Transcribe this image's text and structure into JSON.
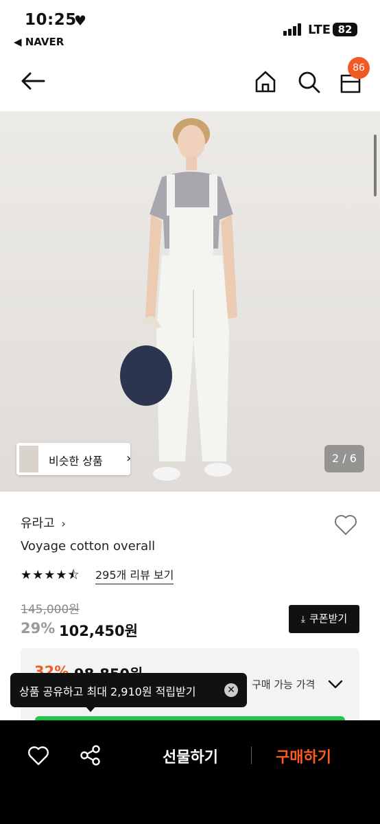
{
  "status": {
    "time": "10:25",
    "back_app": "◀ NAVER",
    "network": "LTE",
    "battery": "82"
  },
  "header": {
    "cart_count": "86"
  },
  "hero": {
    "similar_label": "비슷한 상품",
    "pager": "2 / 6"
  },
  "product": {
    "brand": "유라고",
    "name": "Voyage cotton overall",
    "rating_stars": "★★★★⯪",
    "review_link": "295개 리뷰 보기",
    "original_price": "145,000원",
    "discount": "29%",
    "price": "102,450원",
    "coupon_label": "쿠폰받기"
  },
  "benefit": {
    "discount": "32%",
    "price": "98,850원",
    "label": "구매 가능 가격"
  },
  "tooltip": {
    "text": "상품 공유하고 최대 2,910원 적립받기",
    "close": "✕"
  },
  "bottom_bar": {
    "gift_label": "선물하기",
    "buy_label": "구매하기"
  },
  "colors": {
    "accent": "#f15a24",
    "buy": "#ff5a1f",
    "green": "#21c74b"
  }
}
